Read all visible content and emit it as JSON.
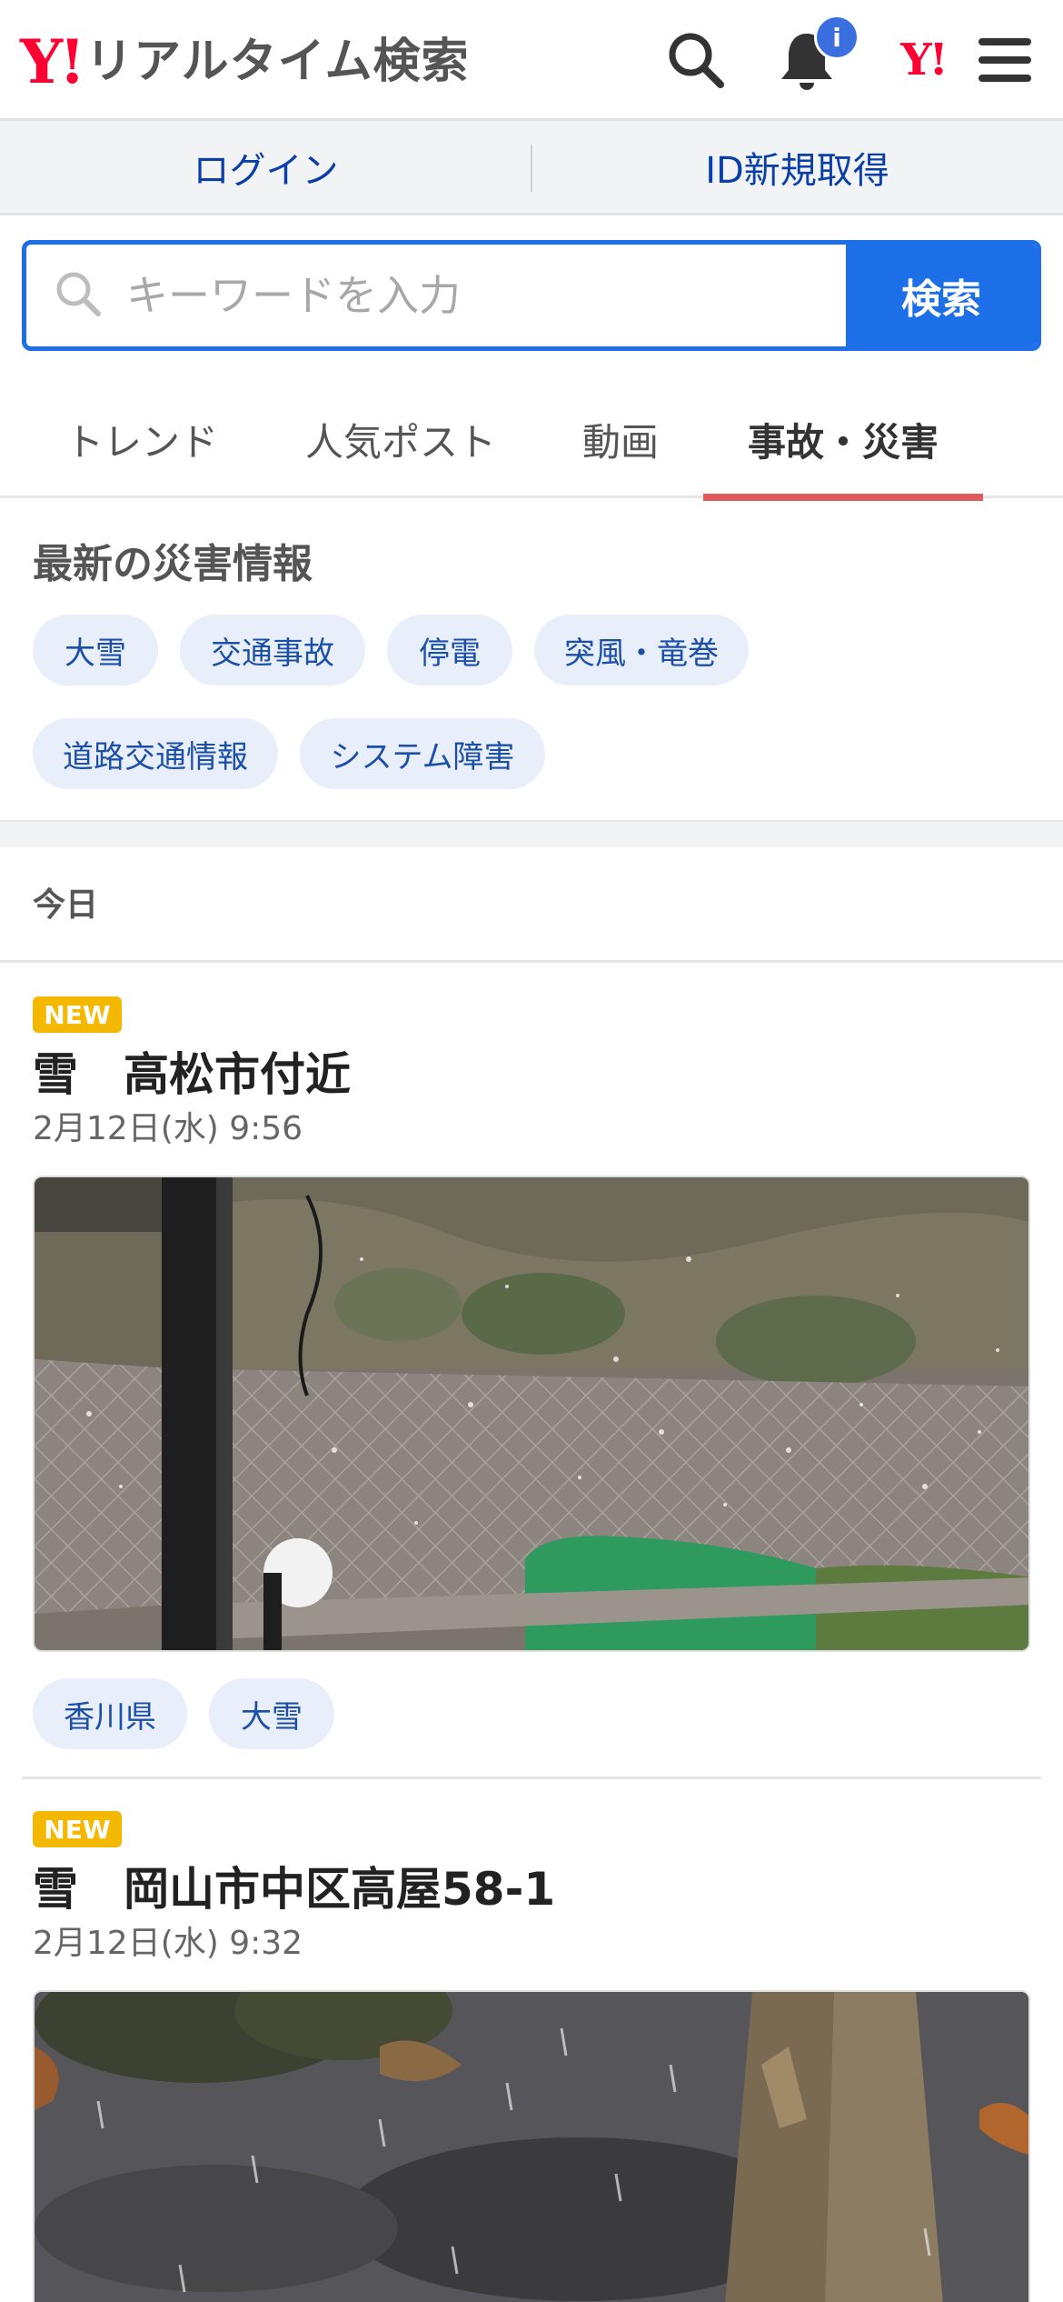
{
  "header": {
    "logo_mark": "Y!",
    "title": "リアルタイム検索",
    "notification_badge": "i",
    "yj_logo": "Y!",
    "icons": [
      "search-icon",
      "bell-icon",
      "menu-icon"
    ]
  },
  "account": {
    "login_label": "ログイン",
    "register_label": "ID新規取得"
  },
  "search": {
    "placeholder": "キーワードを入力",
    "button_label": "検索"
  },
  "tabs": [
    {
      "label": "トレンド",
      "active": false
    },
    {
      "label": "人気ポスト",
      "active": false
    },
    {
      "label": "動画",
      "active": false
    },
    {
      "label": "事故・災害",
      "active": true
    }
  ],
  "disaster": {
    "title": "最新の災害情報",
    "chips": [
      "大雪",
      "交通事故",
      "停電",
      "突風・竜巻",
      "道路交通情報",
      "システム障害"
    ]
  },
  "feed": {
    "date_header": "今日",
    "posts": [
      {
        "badge": "NEW",
        "title": "雪　高松市付近",
        "datetime": "2月12日(水) 9:56",
        "tags": [
          "香川県",
          "大雪"
        ]
      },
      {
        "badge": "NEW",
        "title": "雪　岡山市中区高屋58-1",
        "datetime": "2月12日(水) 9:32",
        "tags": []
      }
    ]
  },
  "colors": {
    "brand_red": "#ff0033",
    "accent_blue": "#1d6fe8",
    "active_tab_underline": "#e05a5a",
    "new_badge": "#f5b800",
    "chip_bg": "#e9eefb"
  }
}
